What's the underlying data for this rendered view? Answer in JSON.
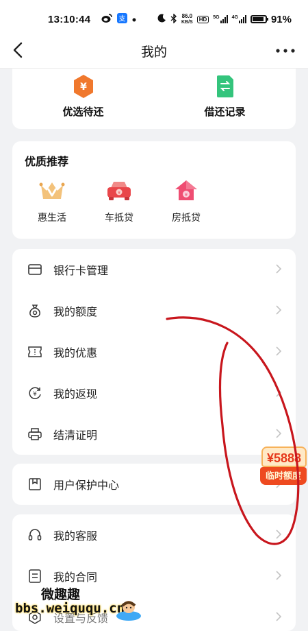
{
  "status_bar": {
    "time": "13:10:44",
    "net_speed_value": "86.0",
    "net_speed_unit": "KB/S",
    "hd_label": "HD",
    "sim1_label": "5G",
    "sim2_label": "4G",
    "battery": "91%"
  },
  "nav": {
    "title": "我的"
  },
  "top_actions": [
    {
      "label": "优选待还",
      "icon": "yen-hexagon-icon",
      "color": "#f0782d"
    },
    {
      "label": "借还记录",
      "icon": "exchange-document-icon",
      "color": "#34c47c"
    }
  ],
  "recommend": {
    "title": "优质推荐",
    "items": [
      {
        "label": "惠生活",
        "icon": "crown-icon"
      },
      {
        "label": "车抵贷",
        "icon": "car-icon"
      },
      {
        "label": "房抵贷",
        "icon": "house-icon"
      }
    ]
  },
  "menu_group_1": [
    {
      "label": "银行卡管理",
      "icon": "bank-card-icon"
    },
    {
      "label": "我的额度",
      "icon": "money-bag-icon"
    },
    {
      "label": "我的优惠",
      "icon": "coupon-icon"
    },
    {
      "label": "我的返现",
      "icon": "cashback-icon"
    },
    {
      "label": "结清证明",
      "icon": "printer-icon"
    }
  ],
  "menu_group_2": [
    {
      "label": "用户保护中心",
      "icon": "bookmark-icon"
    }
  ],
  "menu_group_3": [
    {
      "label": "我的客服",
      "icon": "headset-icon"
    },
    {
      "label": "我的合同",
      "icon": "contract-icon"
    },
    {
      "label": "设置与反馈",
      "icon": "settings-icon"
    }
  ],
  "promo": {
    "amount": "¥5888",
    "tag": "临时额度"
  },
  "watermark": {
    "line1": "微趣趣",
    "line2": "bbs.weiququ.cn"
  },
  "colors": {
    "accent_orange": "#f0782d",
    "accent_green": "#34c47c",
    "promo_red": "#e6391c",
    "scribble_red": "#c8161d"
  }
}
